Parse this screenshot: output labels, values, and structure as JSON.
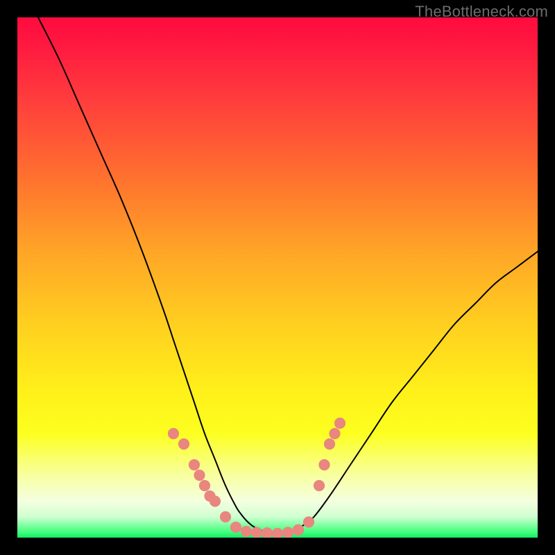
{
  "watermark": "TheBottleneck.com",
  "chart_data": {
    "type": "line",
    "title": "",
    "xlabel": "",
    "ylabel": "",
    "xlim": [
      0,
      100
    ],
    "ylim": [
      0,
      100
    ],
    "grid": false,
    "series": [
      {
        "name": "curve",
        "color": "#000000",
        "x": [
          4,
          8,
          12,
          16,
          20,
          24,
          28,
          30,
          32,
          34,
          36,
          38,
          40,
          42,
          43,
          44,
          45,
          46,
          48,
          50,
          52,
          54,
          55,
          57,
          60,
          64,
          68,
          72,
          76,
          80,
          84,
          88,
          92,
          96,
          100
        ],
        "y": [
          100,
          92,
          83,
          74,
          65,
          55,
          44,
          38,
          32,
          26,
          20,
          15,
          10,
          6,
          4.5,
          3.3,
          2.4,
          1.8,
          1.0,
          0.8,
          1.0,
          1.8,
          2.4,
          4.0,
          8,
          14,
          20,
          26,
          31,
          36,
          41,
          45,
          49,
          52,
          55
        ]
      }
    ],
    "markers": [
      {
        "x": 30,
        "y": 20,
        "r": 1.2,
        "color": "#e8867f"
      },
      {
        "x": 32,
        "y": 18,
        "r": 1.2,
        "color": "#e8867f"
      },
      {
        "x": 34,
        "y": 14,
        "r": 1.2,
        "color": "#e8867f"
      },
      {
        "x": 35,
        "y": 12,
        "r": 1.2,
        "color": "#e8867f"
      },
      {
        "x": 36,
        "y": 10,
        "r": 1.2,
        "color": "#e8867f"
      },
      {
        "x": 37,
        "y": 8,
        "r": 1.2,
        "color": "#e8867f"
      },
      {
        "x": 38,
        "y": 7,
        "r": 1.2,
        "color": "#e8867f"
      },
      {
        "x": 40,
        "y": 4,
        "r": 1.2,
        "color": "#e8867f"
      },
      {
        "x": 42,
        "y": 2,
        "r": 1.2,
        "color": "#e8867f"
      },
      {
        "x": 44,
        "y": 1.2,
        "r": 1.2,
        "color": "#e8867f"
      },
      {
        "x": 46,
        "y": 1.0,
        "r": 1.2,
        "color": "#e8867f"
      },
      {
        "x": 48,
        "y": 0.9,
        "r": 1.2,
        "color": "#e8867f"
      },
      {
        "x": 50,
        "y": 0.8,
        "r": 1.2,
        "color": "#e8867f"
      },
      {
        "x": 52,
        "y": 1.0,
        "r": 1.2,
        "color": "#e8867f"
      },
      {
        "x": 54,
        "y": 1.5,
        "r": 1.2,
        "color": "#e8867f"
      },
      {
        "x": 56,
        "y": 3.0,
        "r": 1.2,
        "color": "#e8867f"
      },
      {
        "x": 58,
        "y": 10,
        "r": 1.2,
        "color": "#e8867f"
      },
      {
        "x": 59,
        "y": 14,
        "r": 1.2,
        "color": "#e8867f"
      },
      {
        "x": 60,
        "y": 18,
        "r": 1.2,
        "color": "#e8867f"
      },
      {
        "x": 61,
        "y": 20,
        "r": 1.2,
        "color": "#e8867f"
      },
      {
        "x": 62,
        "y": 22,
        "r": 1.2,
        "color": "#e8867f"
      }
    ]
  }
}
